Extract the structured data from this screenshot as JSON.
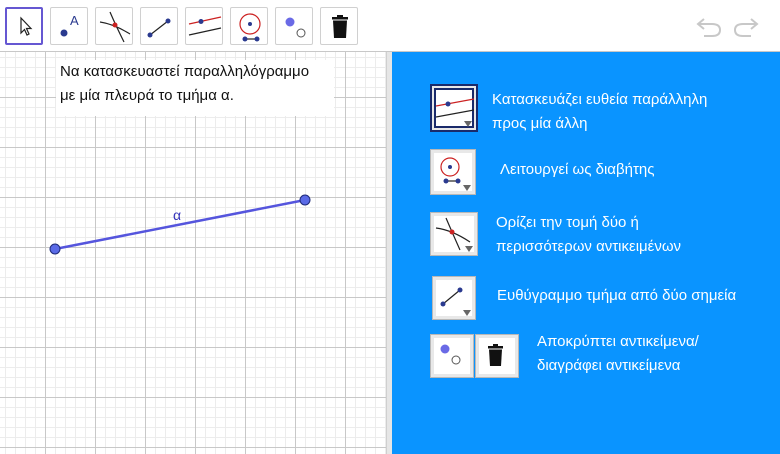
{
  "toolbar": {
    "tools": [
      "move-tool",
      "point-tool",
      "intersect-tool",
      "segment-tool",
      "parallel-line-tool",
      "compass-tool",
      "show-hide-object-tool",
      "delete-tool"
    ],
    "point_label": "A"
  },
  "graphics": {
    "task_line1": "Να κατασκευαστεί παραλληλόγραμμο",
    "task_line2": "με μία πλευρά το τμήμα α.",
    "segment_label": "α"
  },
  "panel": {
    "items": [
      {
        "icon": "parallel-line-icon",
        "line1": "Κατασκευάζει ευθεία παράλληλη",
        "line2": "προς μία άλλη"
      },
      {
        "icon": "compass-icon",
        "line1": "Λειτουργεί ως διαβήτης"
      },
      {
        "icon": "intersect-icon",
        "line1": "Ορίζει την τομή δύο ή",
        "line2": "περισσότερων αντικειμένων"
      },
      {
        "icon": "segment-icon",
        "line1": "Ευθύγραμμο τμήμα από δύο σημεία"
      },
      {
        "icon": "show-hide-delete-icons",
        "line1": "Αποκρύπτει αντικείμενα/",
        "line2": "διαγράφει αντικείμενα"
      }
    ]
  },
  "colors": {
    "panel_bg": "#0a94ff",
    "segment": "#5555dd",
    "active_tool": "#6557d2"
  }
}
